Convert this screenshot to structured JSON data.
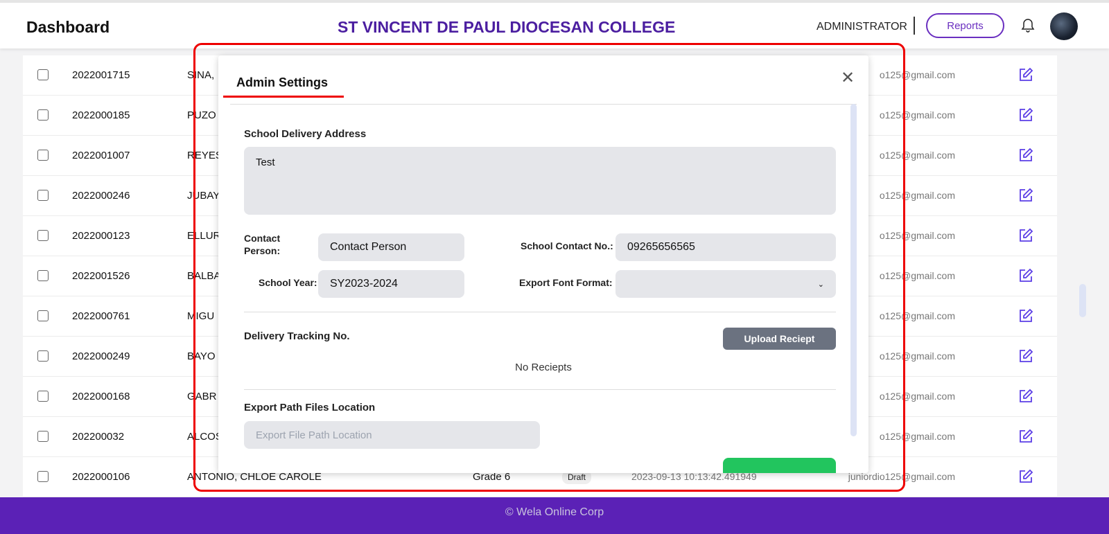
{
  "header": {
    "title": "Dashboard",
    "school": "ST VINCENT DE PAUL DIOCESAN COLLEGE",
    "user": "ADMINISTRATOR",
    "reports": "Reports"
  },
  "rows": [
    {
      "id": "2022001715",
      "name": "SINA,",
      "email": "o125@gmail.com"
    },
    {
      "id": "2022000185",
      "name": "PUZO",
      "email": "o125@gmail.com"
    },
    {
      "id": "2022001007",
      "name": "REYES",
      "email": "o125@gmail.com"
    },
    {
      "id": "2022000246",
      "name": "JUBAY",
      "email": "o125@gmail.com"
    },
    {
      "id": "2022000123",
      "name": "ELLUR",
      "email": "o125@gmail.com"
    },
    {
      "id": "2022001526",
      "name": "BALBA",
      "email": "o125@gmail.com"
    },
    {
      "id": "2022000761",
      "name": "MIGU",
      "email": "o125@gmail.com"
    },
    {
      "id": "2022000249",
      "name": "BAYO",
      "email": "o125@gmail.com"
    },
    {
      "id": "2022000168",
      "name": "GABR",
      "email": "o125@gmail.com"
    },
    {
      "id": "202200032",
      "name": "ALCOS",
      "email": "o125@gmail.com"
    },
    {
      "id": "2022000106",
      "name": "ANTONIO, CHLOE CAROLE",
      "grade": "Grade 6",
      "status": "Draft",
      "date": "2023-09-13 10:13:42.491949",
      "email": "juniordio125@gmail.com"
    }
  ],
  "modal": {
    "title": "Admin Settings",
    "address_label": "School Delivery Address",
    "address": "Test",
    "contact_label": "Contact Person:",
    "contact": "Contact Person",
    "phone_label": "School Contact No.:",
    "phone": "09265656565",
    "year_label": "School Year:",
    "year": "SY2023-2024",
    "font_label": "Export Font Format:",
    "font": "",
    "tracking_label": "Delivery Tracking No.",
    "upload": "Upload Reciept",
    "no_receipts": "No Reciepts",
    "path_label": "Export Path Files Location",
    "path_placeholder": "Export File Path Location"
  },
  "footer": "© Wela Online Corp"
}
